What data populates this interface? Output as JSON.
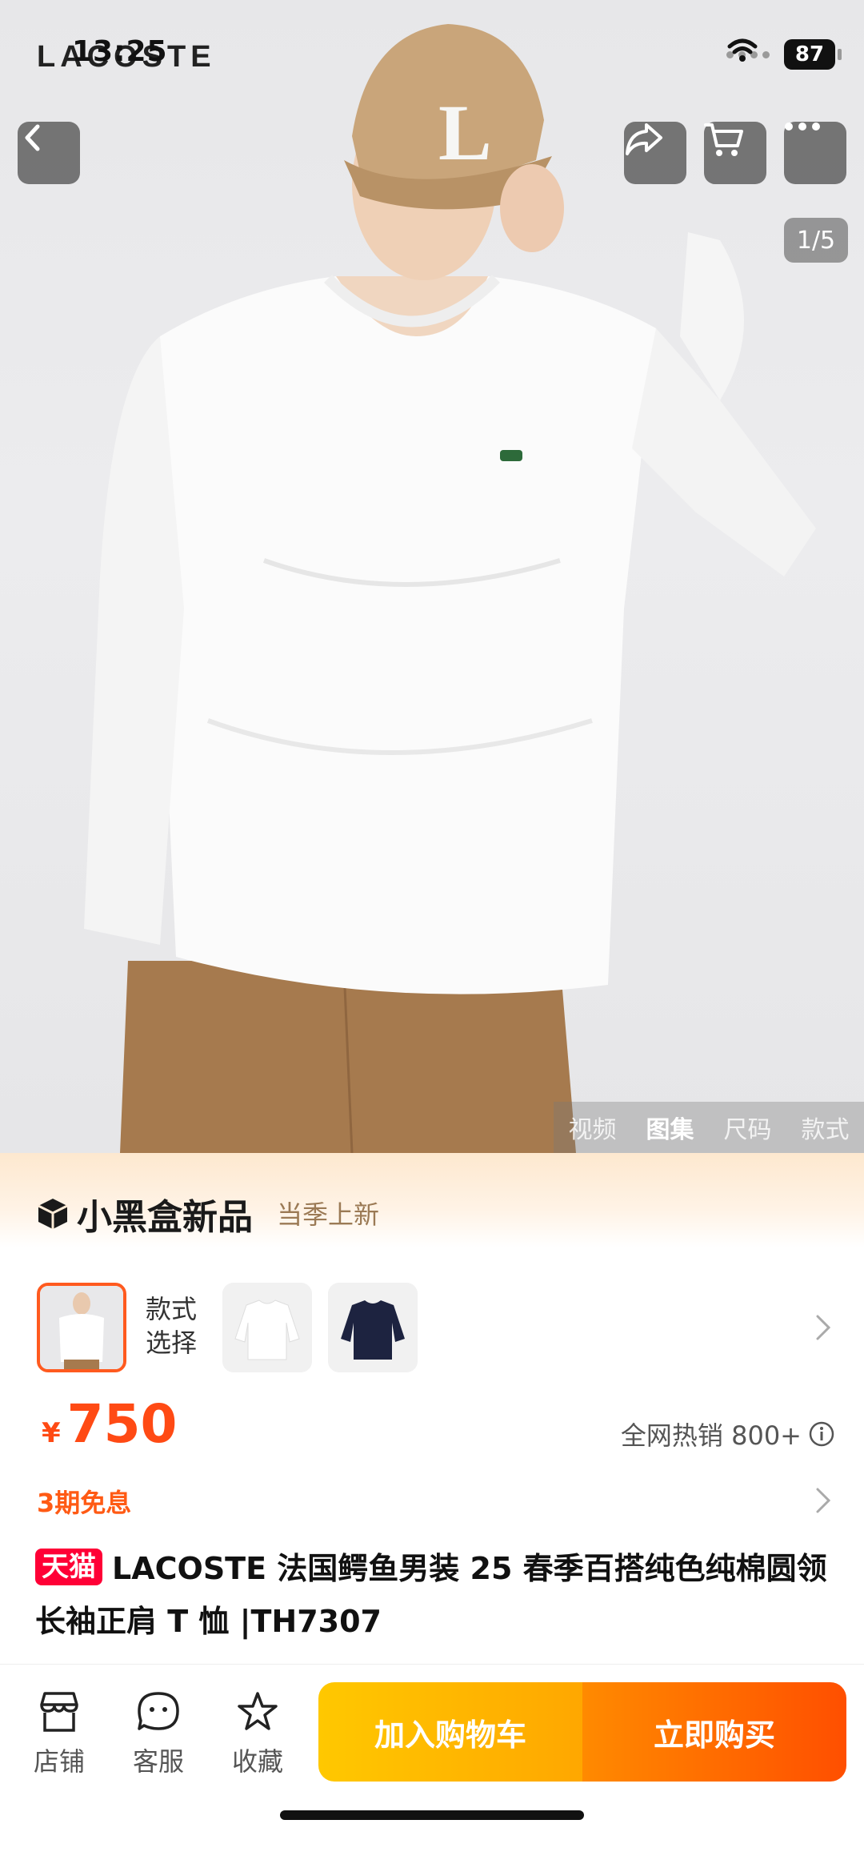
{
  "status_bar": {
    "time": "13:25",
    "brand_watermark": "LACOSTE",
    "battery": "87"
  },
  "gallery": {
    "counter": "1/5",
    "tabs": [
      {
        "label": "视频",
        "active": false
      },
      {
        "label": "图集",
        "active": true
      },
      {
        "label": "尺码",
        "active": false
      },
      {
        "label": "款式",
        "active": false
      }
    ],
    "cap_letter": "L"
  },
  "promo": {
    "logo_text": "小黑盒新品",
    "subtitle": "当季上新"
  },
  "variants": {
    "label_line1": "款式",
    "label_line2": "选择"
  },
  "price": {
    "currency": "¥",
    "amount": "750",
    "sales_text": "全网热销 800+"
  },
  "installment": "3期免息",
  "product": {
    "badge": "天猫",
    "title": "LACOSTE 法国鳄鱼男装 25 春季百搭纯色纯棉圆领长袖正肩 T 恤 |TH7307"
  },
  "bottom_bar": {
    "shop": "店铺",
    "service": "客服",
    "favorite": "收藏",
    "add_to_cart": "加入购物车",
    "buy_now": "立即购买"
  },
  "colors": {
    "accent": "#ff4a14",
    "tmall_red": "#ff0036",
    "cart_button": "#ffb400",
    "buy_button": "#ff6a00"
  }
}
